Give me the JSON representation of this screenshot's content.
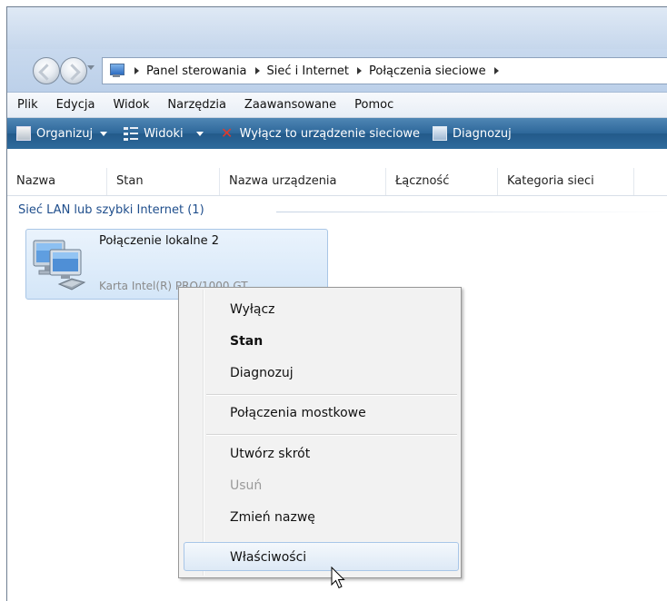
{
  "address": {
    "breadcrumbs": [
      "Panel sterowania",
      "Sieć i Internet",
      "Połączenia sieciowe"
    ]
  },
  "menu": [
    "Plik",
    "Edycja",
    "Widok",
    "Narzędzia",
    "Zaawansowane",
    "Pomoc"
  ],
  "toolbar": {
    "organize": "Organizuj",
    "views": "Widoki",
    "disable": "Wyłącz to urządzenie sieciowe",
    "diagnose": "Diagnozuj"
  },
  "columns": [
    "Nazwa",
    "Stan",
    "Nazwa urządzenia",
    "Łączność",
    "Kategoria sieci"
  ],
  "group": {
    "title": "Sieć LAN lub szybki Internet (1)"
  },
  "connection": {
    "name": "Połączenie lokalne 2",
    "device": "Karta Intel(R) PRO/1000 GT ..."
  },
  "context_menu": {
    "disable": "Wyłącz",
    "status": "Stan",
    "diagnose": "Diagnozuj",
    "bridge": "Połączenia mostkowe",
    "shortcut": "Utwórz skrót",
    "delete": "Usuń",
    "rename": "Zmień nazwę",
    "properties": "Właściwości"
  },
  "colors": {
    "toolbar": "#2d679a",
    "group_header": "#1f4e8c",
    "highlight_border": "#a8c6e8"
  }
}
